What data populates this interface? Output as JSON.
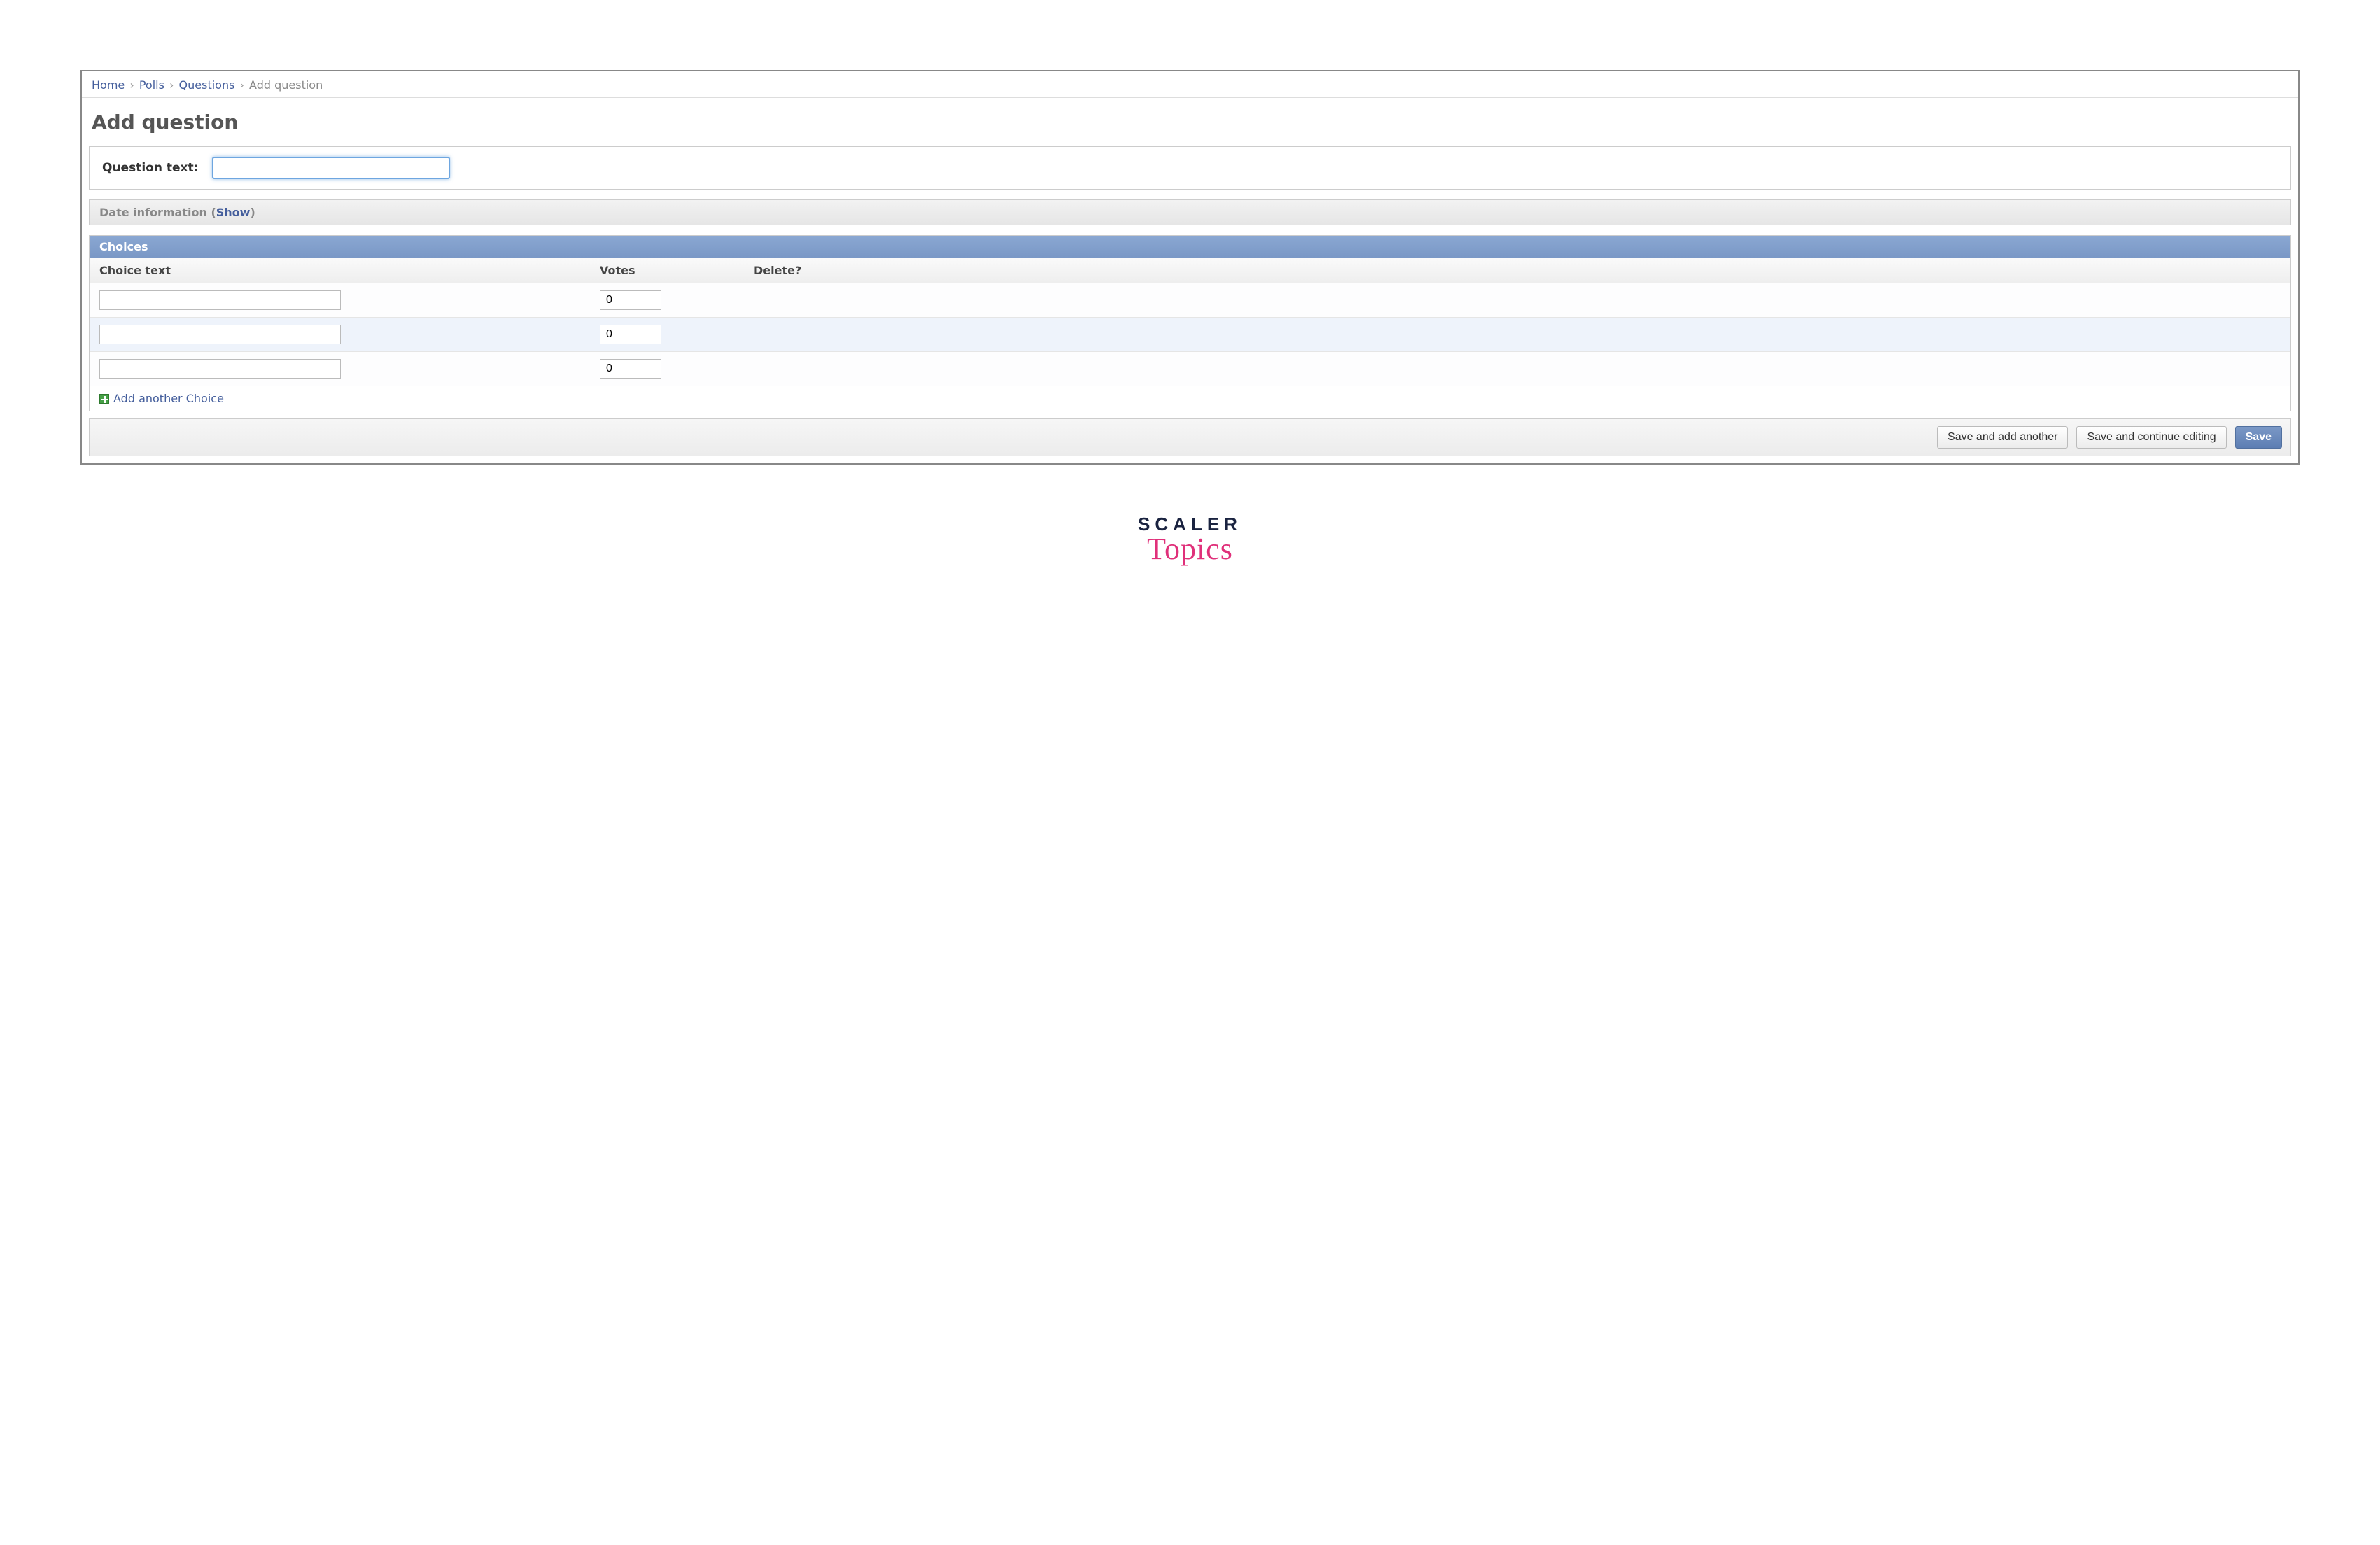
{
  "breadcrumbs": {
    "home": "Home",
    "app": "Polls",
    "model": "Questions",
    "current": "Add question"
  },
  "page_title": "Add question",
  "form": {
    "question_label": "Question text:",
    "question_value": ""
  },
  "date_section": {
    "label": "Date information",
    "toggle": "Show"
  },
  "inline": {
    "title": "Choices",
    "columns": {
      "text": "Choice text",
      "votes": "Votes",
      "delete": "Delete?"
    },
    "rows": [
      {
        "text": "",
        "votes": "0"
      },
      {
        "text": "",
        "votes": "0"
      },
      {
        "text": "",
        "votes": "0"
      }
    ],
    "add_another": "Add another Choice"
  },
  "buttons": {
    "save_add_another": "Save and add another",
    "save_continue": "Save and continue editing",
    "save": "Save"
  },
  "branding": {
    "line1": "SCALER",
    "line2": "Topics"
  }
}
